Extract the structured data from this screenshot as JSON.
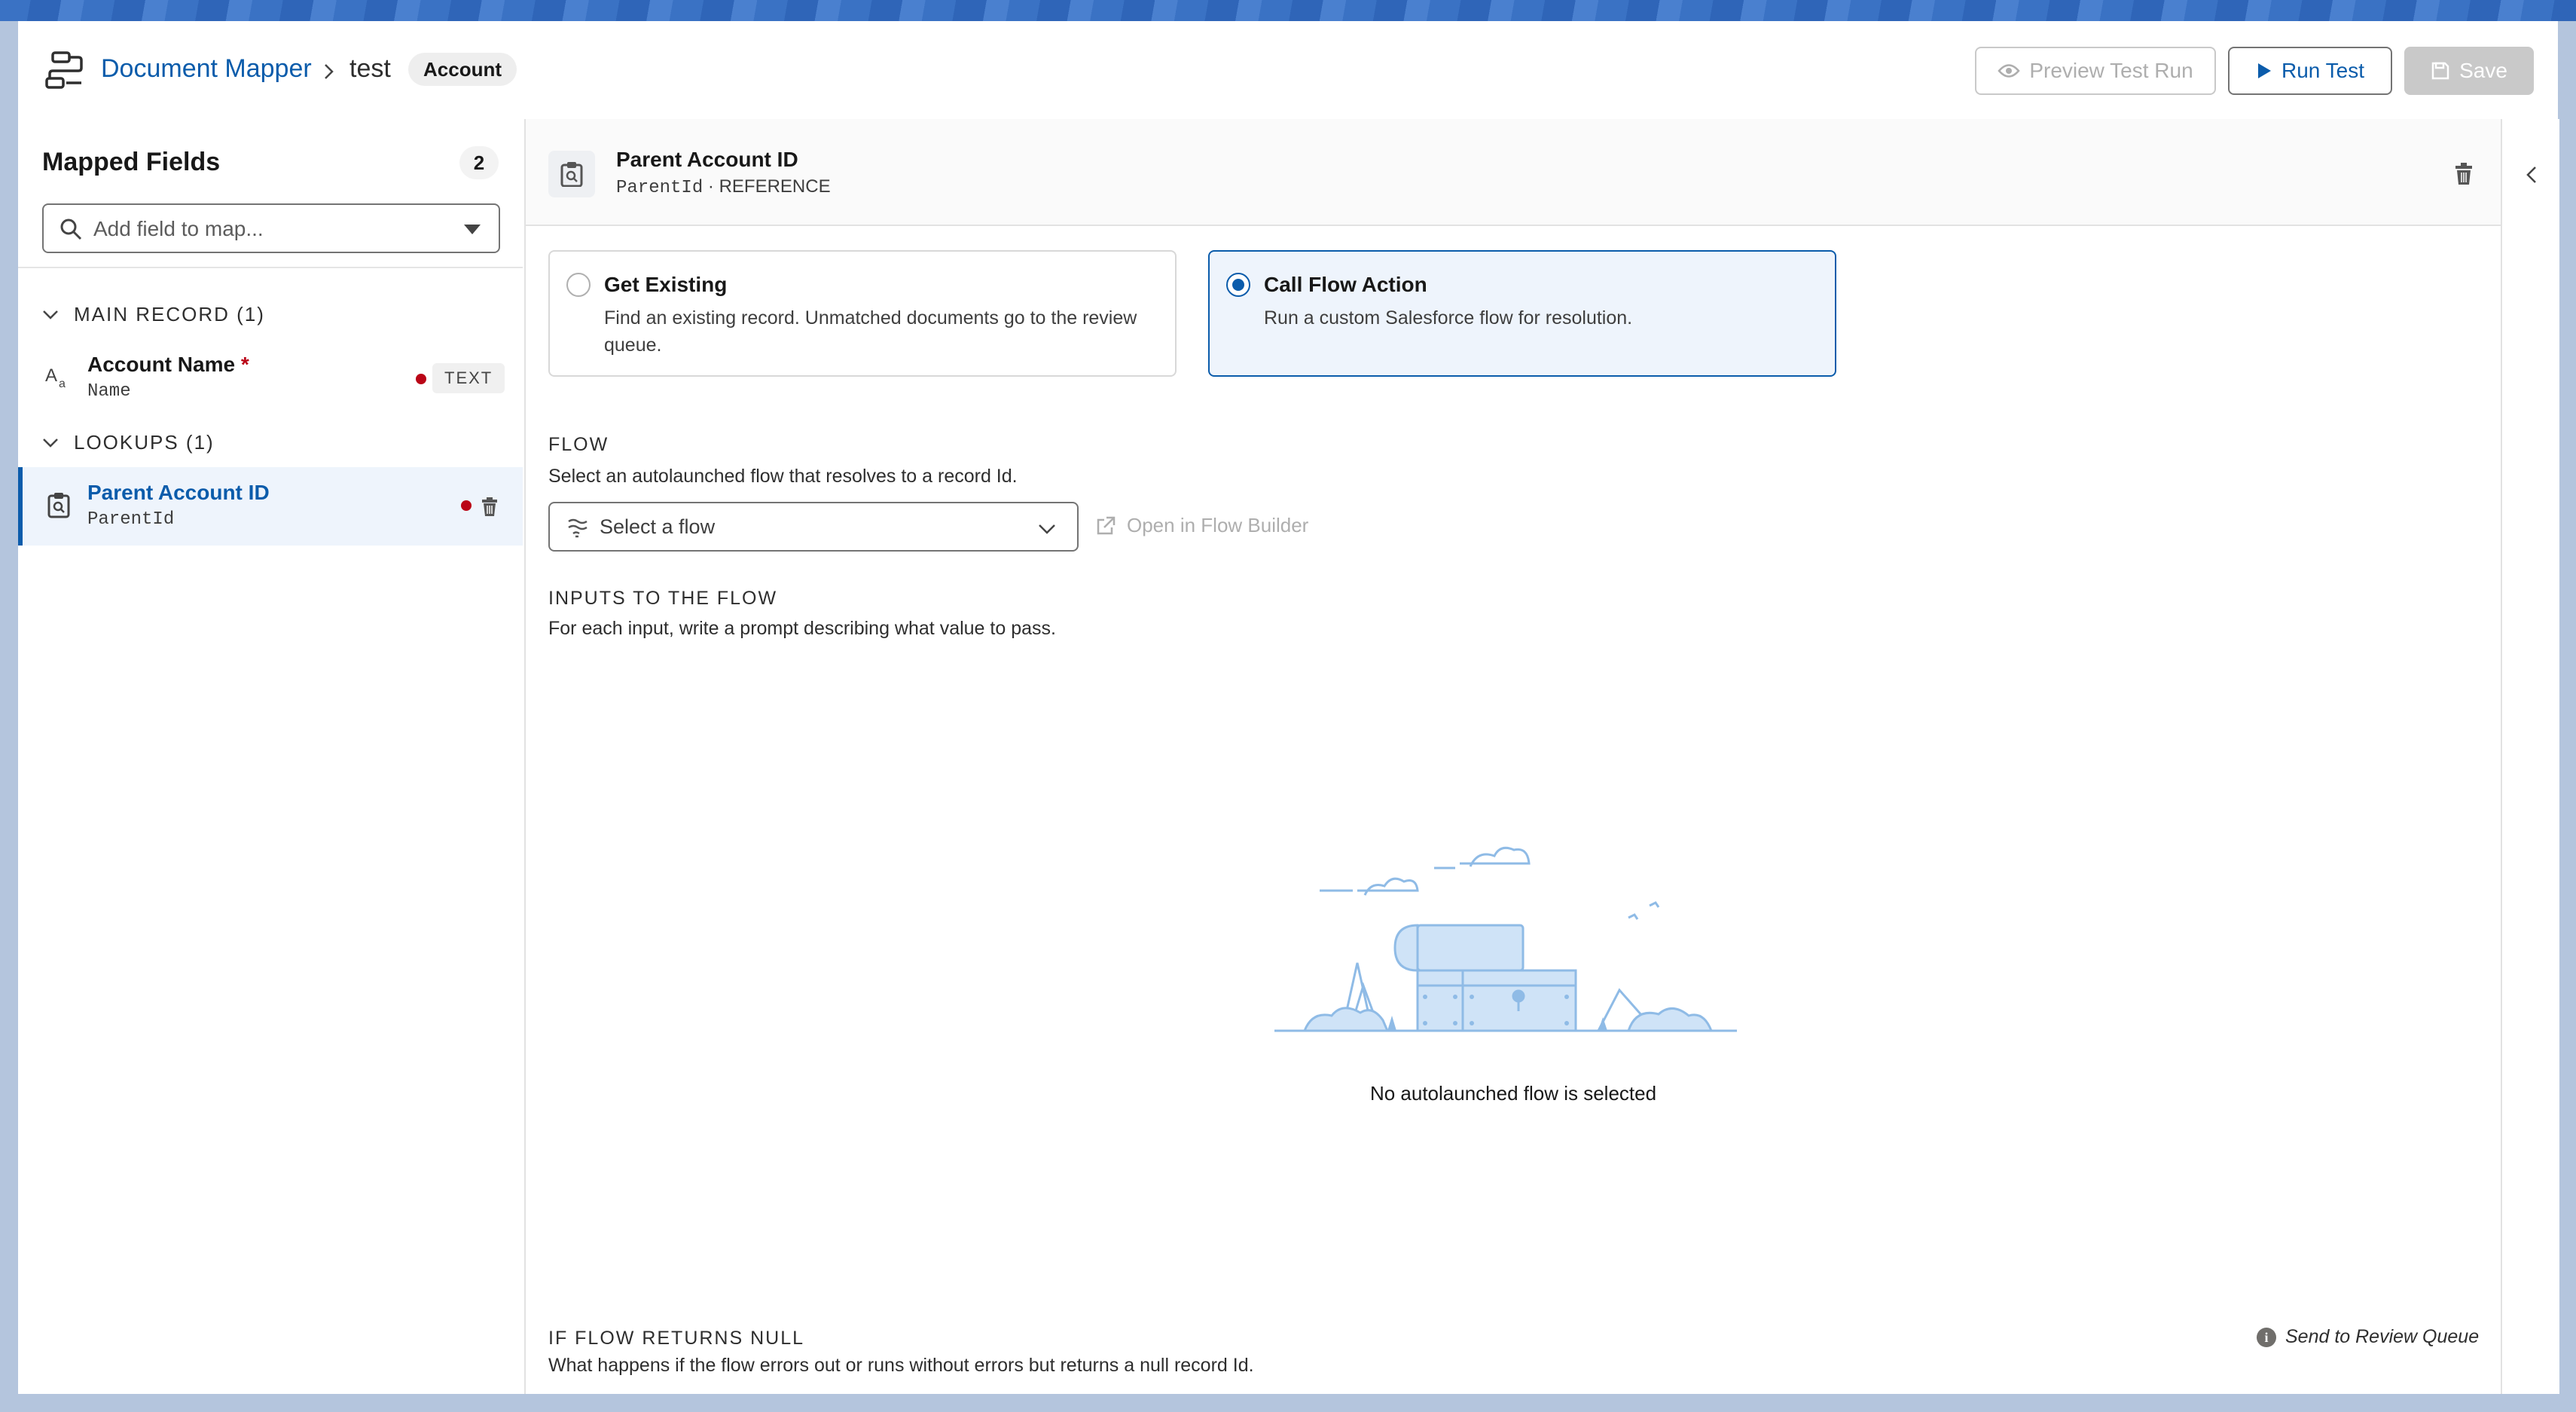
{
  "header": {
    "app_title": "Document Mapper",
    "crumb": "test",
    "object_badge": "Account",
    "preview_label": "Preview Test Run",
    "run_label": "Run Test",
    "save_label": "Save",
    "accent": "#0b5cab"
  },
  "sidebar": {
    "title": "Mapped Fields",
    "count": "2",
    "search_placeholder": "Add field to map...",
    "sections": [
      {
        "label": "MAIN RECORD (1)",
        "fields": [
          {
            "label": "Account Name",
            "required_mark": "*",
            "api": "Name",
            "type": "TEXT",
            "icon": "text-field-icon",
            "status_color": "#ba0517"
          }
        ]
      },
      {
        "label": "LOOKUPS (1)",
        "fields": [
          {
            "label": "Parent Account ID",
            "api": "ParentId",
            "icon": "lookup-icon",
            "selected": true,
            "status_color": "#ba0517"
          }
        ]
      }
    ]
  },
  "detail": {
    "field_title": "Parent Account ID",
    "field_api": "ParentId",
    "field_type_sep": "·",
    "field_type": "REFERENCE",
    "options": [
      {
        "title": "Get Existing",
        "desc": "Find an existing record. Unmatched documents go to the review queue.",
        "selected": false
      },
      {
        "title": "Call Flow Action",
        "desc": "Run a custom Salesforce flow for resolution.",
        "selected": true
      }
    ],
    "flow": {
      "label": "FLOW",
      "desc": "Select an autolaunched flow that resolves to a record Id.",
      "select_placeholder": "Select a flow",
      "open_builder": "Open in Flow Builder"
    },
    "inputs": {
      "label": "INPUTS TO THE FLOW",
      "desc": "For each input, write a prompt describing what value to pass.",
      "empty_message": "No autolaunched flow is selected"
    },
    "null_handling": {
      "label": "IF FLOW RETURNS NULL",
      "desc": "What happens if the flow errors out or runs without errors but returns a null record Id.",
      "action": "Send to Review Queue",
      "info_glyph": "i"
    }
  }
}
